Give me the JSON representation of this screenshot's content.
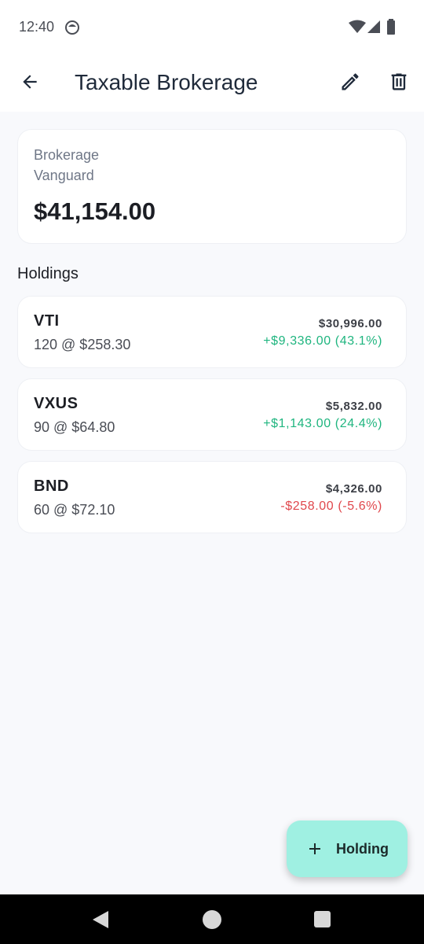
{
  "status_bar": {
    "time": "12:40"
  },
  "app_bar": {
    "title": "Taxable Brokerage",
    "back_icon": "arrow-back-icon",
    "edit_icon": "pencil-icon",
    "delete_icon": "trash-icon"
  },
  "account": {
    "type": "Brokerage",
    "institution": "Vanguard",
    "balance": "$41,154.00"
  },
  "holdings_section": {
    "title": "Holdings"
  },
  "holdings": [
    {
      "symbol": "VTI",
      "detail": "120 @ $258.30",
      "value": "$30,996.00",
      "change": "+$9,336.00 (43.1%)",
      "direction": "gain"
    },
    {
      "symbol": "VXUS",
      "detail": "90 @ $64.80",
      "value": "$5,832.00",
      "change": "+$1,143.00 (24.4%)",
      "direction": "gain"
    },
    {
      "symbol": "BND",
      "detail": "60 @ $72.10",
      "value": "$4,326.00",
      "change": "-$258.00 (-5.6%)",
      "direction": "loss"
    }
  ],
  "fab": {
    "label": "Holding",
    "icon": "plus-icon"
  },
  "colors": {
    "gain": "#1fb57f",
    "loss": "#e0474c",
    "fab_background": "#9ff0e2",
    "title": "#1f2a3a"
  }
}
